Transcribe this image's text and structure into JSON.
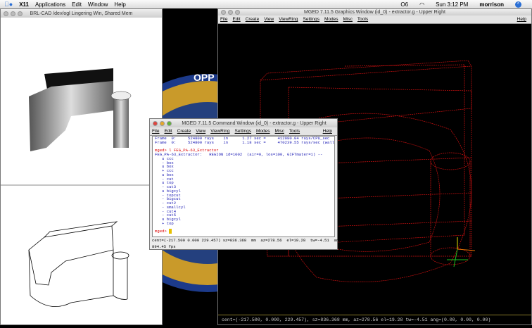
{
  "menubar": {
    "app": "X11",
    "items": [
      "Applications",
      "Edit",
      "Window",
      "Help"
    ],
    "status_right": [
      "O6",
      "Sun 3:12 PM",
      "morrison"
    ]
  },
  "left_window": {
    "title": "BRL-CAD /dev/ogl Lingering Win, Shared Mem"
  },
  "graphics_window": {
    "title": "MGED 7.11.5 Graphics Window (id_0) - extractor.g - Upper Right",
    "menu": [
      "File",
      "Edit",
      "Create",
      "View",
      "ViewRing",
      "Settings",
      "Modes",
      "Misc",
      "Tools"
    ],
    "help": "Help",
    "status": "cent=(-217.500, 0.000, 229.457), sz=836.368 mm, az=278.56 el=19.28 tw=-4.51 ang=(0.00, 0.00, 0.00)",
    "wire_color": "#d01010"
  },
  "command_window": {
    "title": "MGED 7.11.5 Command Window (id_0) - extractor.g - Upper Right",
    "menu": [
      "File",
      "Edit",
      "Create",
      "View",
      "ViewRing",
      "Settings",
      "Modes",
      "Misc",
      "Tools"
    ],
    "help": "Help",
    "output_lines": [
      "Frame  0:     524800 rays    in      1.27 sec =     412080.04 rays/CPU_sec",
      "Frame  0:     524800 rays    in      1.18 sec =     470239.55 rays/sec (wallclock)"
    ],
    "command": "mged> l FEG_PA-63_Extractor",
    "region_line": "FEG_PA-63_Extractor:   REGION id=1002  (air=0, los=100, GIFTmater=1) --",
    "tree": [
      "u ccc",
      "- box",
      "u box",
      "+ ccc",
      "u box",
      "- cut",
      "u top",
      "- cut3",
      "u bigcyl",
      "- topcut",
      "- bigcut",
      "- cut2",
      "- smallcyl",
      "- cut4",
      "- cut5",
      "u bigcyl",
      "+ top"
    ],
    "prompt": "mged> ",
    "status1": "cent=(-217.500 0.000 229.457) sz=836.368  mm  az=278.56  el=19.28  tw=-4.51  ang=(0.00 0.00 0.00)",
    "status2": "894.45 fps"
  }
}
